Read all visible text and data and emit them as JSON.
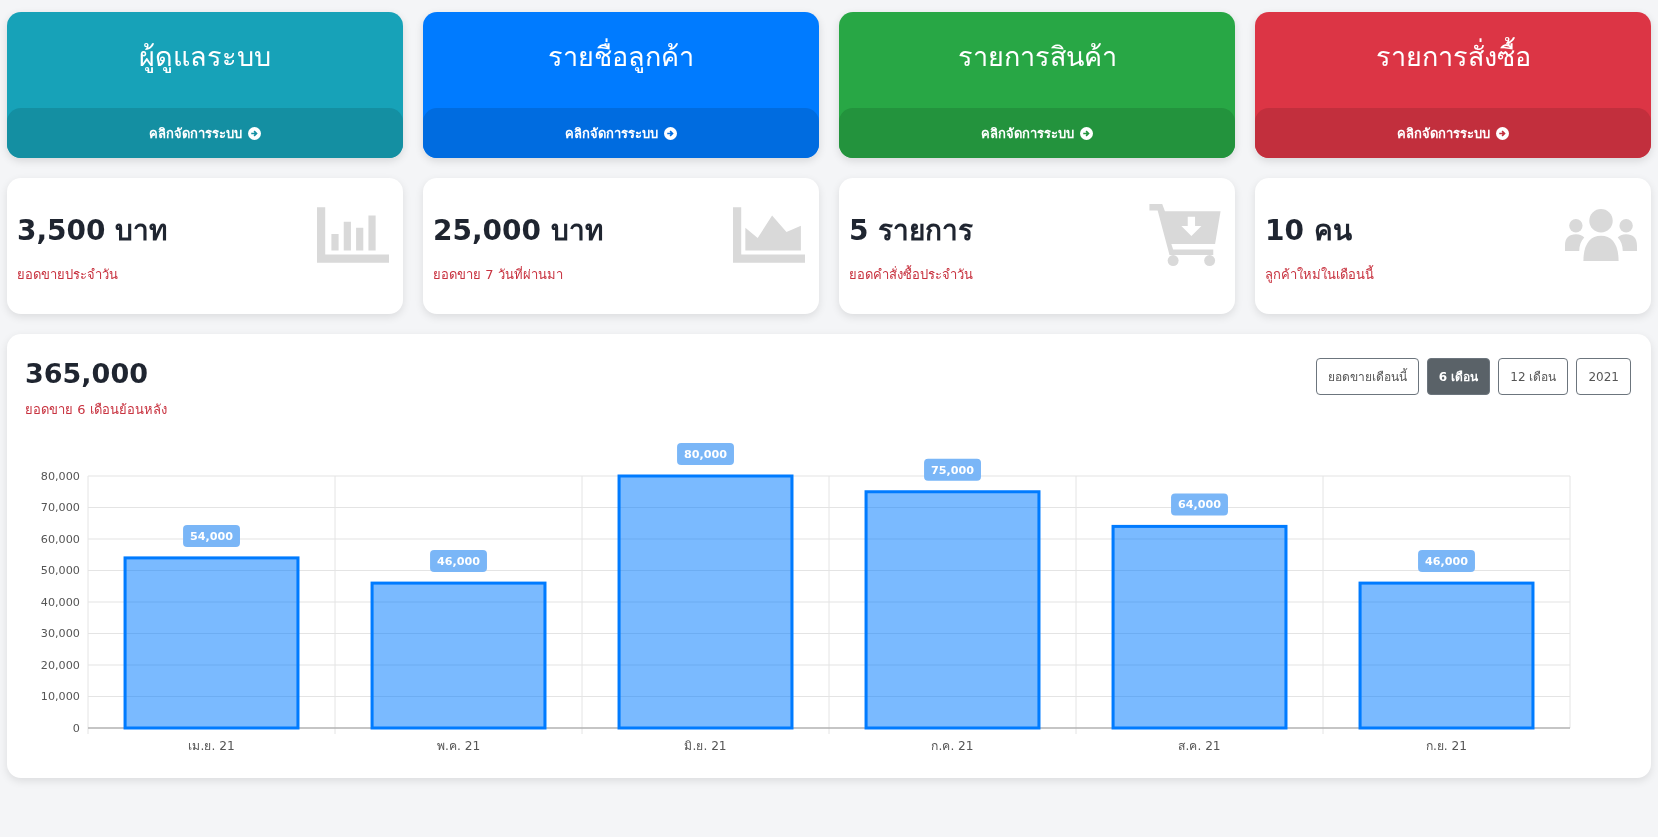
{
  "menu_cards": [
    {
      "title": "ผู้ดูแลระบบ",
      "link": "คลิกจัดการระบบ",
      "color": "#17a2b8"
    },
    {
      "title": "รายชื่อลูกค้า",
      "link": "คลิกจัดการระบบ",
      "color": "#007bff"
    },
    {
      "title": "รายการสินค้า",
      "link": "คลิกจัดการระบบ",
      "color": "#28a745"
    },
    {
      "title": "รายการสั่งซื้อ",
      "link": "คลิกจัดการระบบ",
      "color": "#dc3545"
    }
  ],
  "stat_cards": [
    {
      "value": "3,500 บาท",
      "label": "ยอดขายประจำวัน",
      "kind": "bars"
    },
    {
      "value": "25,000 บาท",
      "label": "ยอดขาย 7 วันที่ผ่านมา",
      "kind": "area"
    },
    {
      "value": "5 รายการ",
      "label": "ยอดคำสั่งซื้อประจำวัน",
      "kind": "cart"
    },
    {
      "value": "10 คน",
      "label": "ลูกค้าใหม่ในเดือนนี้",
      "kind": "users"
    }
  ],
  "sales_panel": {
    "total": "365,000",
    "subtitle": "ยอดขาย 6 เดือนย้อนหลัง",
    "ranges": [
      {
        "label": "ยอดขายเดือนนี้",
        "selected": false
      },
      {
        "label": "6 เดือน",
        "selected": true
      },
      {
        "label": "12 เดือน",
        "selected": false
      },
      {
        "label": "2021",
        "selected": false
      }
    ],
    "chart_data": {
      "type": "bar",
      "categories": [
        "เม.ย. 21",
        "พ.ค. 21",
        "มิ.ย. 21",
        "ก.ค. 21",
        "ส.ค. 21",
        "ก.ย. 21"
      ],
      "series": [
        {
          "color": "#007bff",
          "values": [
            54000,
            46000,
            80000,
            75000,
            64000,
            46000
          ]
        }
      ],
      "ylim": [
        0,
        80000
      ],
      "yticks": [
        {
          "value": 0,
          "label": "0"
        },
        {
          "value": 10000,
          "label": "10,000"
        },
        {
          "value": 20000,
          "label": "20,000"
        },
        {
          "value": 30000,
          "label": "30,000"
        },
        {
          "value": 40000,
          "label": "40,000"
        },
        {
          "value": 50000,
          "label": "50,000"
        },
        {
          "value": 60000,
          "label": "60,000"
        },
        {
          "value": 70000,
          "label": "70,000"
        },
        {
          "value": 80000,
          "label": "80,000"
        }
      ],
      "grid": true,
      "value_labels": [
        "54,000",
        "46,000",
        "80,000",
        "75,000",
        "64,000",
        "46,000"
      ]
    }
  }
}
